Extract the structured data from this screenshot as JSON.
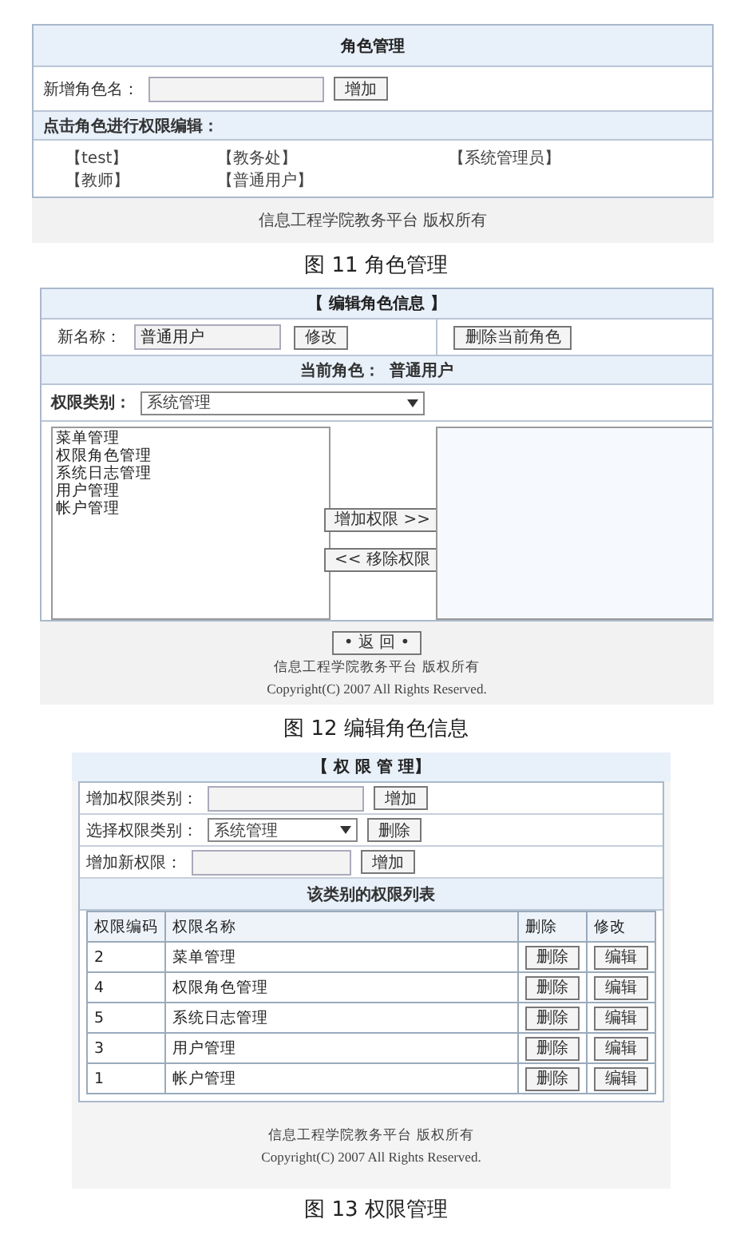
{
  "role_management": {
    "title": "角色管理",
    "new_role_label": "新增角色名：",
    "add_button": "增加",
    "edit_hint": "点击角色进行权限编辑：",
    "roles": [
      "【test】",
      "【教务处】",
      "【系统管理员】",
      "【教师】",
      "【普通用户】"
    ],
    "footer": "信息工程学院教务平台 版权所有",
    "caption": "图 11 角色管理"
  },
  "edit_role": {
    "title": "【 编辑角色信息 】",
    "name_label": "新名称：",
    "name_value": "普通用户",
    "modify_button": "修改",
    "delete_button": "删除当前角色",
    "current_role_label": "当前角色：",
    "current_role": "普通用户",
    "category_label": "权限类别：",
    "category_value": "系统管理",
    "available": [
      "菜单管理",
      "权限角色管理",
      "系统日志管理",
      "用户管理",
      "帐户管理"
    ],
    "add_button": "增加权限 >>",
    "remove_button": "<< 移除权限",
    "back_button": "• 返 回 •",
    "footer": [
      "信息工程学院教务平台 版权所有",
      "Copyright(C) 2007 All Rights Reserved."
    ],
    "caption": "图 12 编辑角色信息"
  },
  "permission_management": {
    "title": "【 权 限 管 理】",
    "add_category_label": "增加权限类别：",
    "add_category_button": "增加",
    "select_category_label": "选择权限类别：",
    "select_category_value": "系统管理",
    "select_delete_button": "删除",
    "add_permission_label": "增加新权限：",
    "add_permission_button": "增加",
    "list_title": "该类别的权限列表",
    "columns": [
      "权限编码",
      "权限名称",
      "删除",
      "修改"
    ],
    "rows": [
      {
        "code": "2",
        "name": "菜单管理",
        "delete": "删除",
        "edit": "编辑"
      },
      {
        "code": "4",
        "name": "权限角色管理",
        "delete": "删除",
        "edit": "编辑"
      },
      {
        "code": "5",
        "name": "系统日志管理",
        "delete": "删除",
        "edit": "编辑"
      },
      {
        "code": "3",
        "name": "用户管理",
        "delete": "删除",
        "edit": "编辑"
      },
      {
        "code": "1",
        "name": "帐户管理",
        "delete": "删除",
        "edit": "编辑"
      }
    ],
    "footer": [
      "信息工程学院教务平台 版权所有",
      "Copyright(C) 2007 All Rights Reserved."
    ],
    "caption": "图 13 权限管理"
  }
}
